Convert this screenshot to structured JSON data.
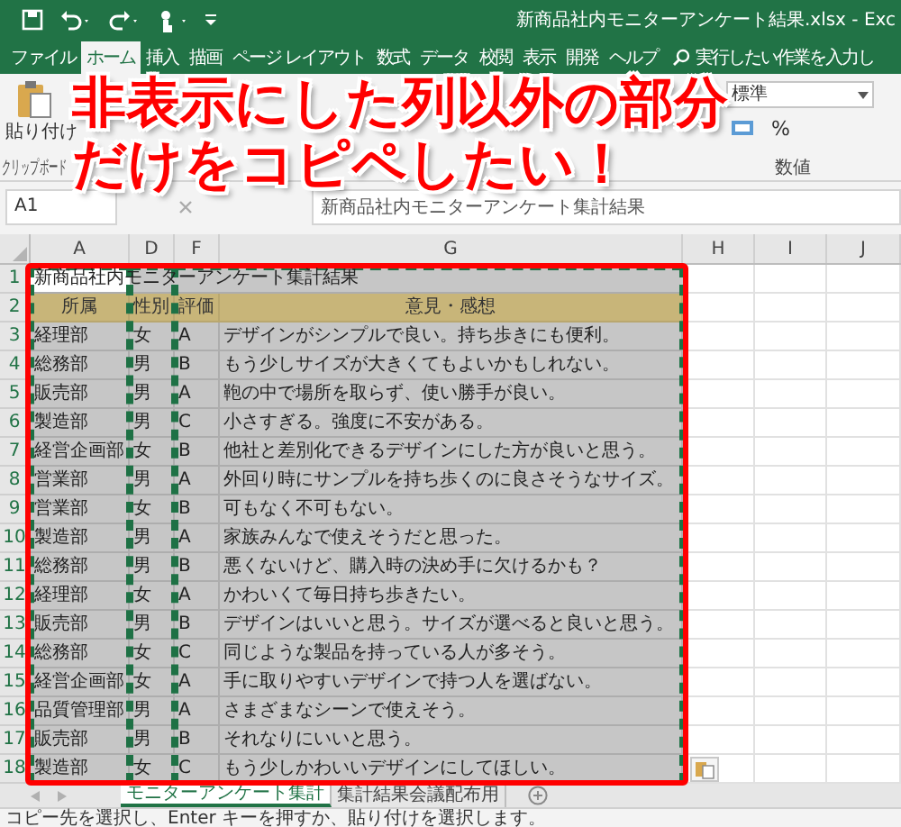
{
  "title_bar": {
    "title": "新商品社内モニターアンケート結果.xlsx - Exc"
  },
  "ribbon_tabs": [
    {
      "label": "ファイル",
      "selected": false
    },
    {
      "label": "ホーム",
      "selected": true
    },
    {
      "label": "挿入",
      "selected": false
    },
    {
      "label": "描画",
      "selected": false
    },
    {
      "label": "ページ レイアウト",
      "selected": false
    },
    {
      "label": "数式",
      "selected": false
    },
    {
      "label": "データ",
      "selected": false
    },
    {
      "label": "校閲",
      "selected": false
    },
    {
      "label": "表示",
      "selected": false
    },
    {
      "label": "開発",
      "selected": false
    },
    {
      "label": "ヘルプ",
      "selected": false
    }
  ],
  "tell_me": {
    "placeholder": "実行したい作業を入力し"
  },
  "ribbon": {
    "paste_label": "貼り付け",
    "clipboard_group": "クリップボード",
    "number_format": "標準",
    "percent": "%",
    "number_group": "数値"
  },
  "formula_bar": {
    "name_box": "A1",
    "formula": "新商品社内モニターアンケート集計結果"
  },
  "columns": [
    "A",
    "D",
    "F",
    "G",
    "H",
    "I",
    "J"
  ],
  "rows": [
    {
      "number": "1",
      "kind": "title",
      "text": "新商品社内モニターアンケート集計結果"
    },
    {
      "number": "2",
      "kind": "header",
      "cells": [
        "所属",
        "性別",
        "評価",
        "意見・感想"
      ]
    },
    {
      "number": "3",
      "kind": "data",
      "cells": [
        "経理部",
        "女",
        "A",
        "デザインがシンプルで良い。持ち歩きにも便利。"
      ]
    },
    {
      "number": "4",
      "kind": "data",
      "cells": [
        "総務部",
        "男",
        "B",
        "もう少しサイズが大きくてもよいかもしれない。"
      ]
    },
    {
      "number": "5",
      "kind": "data",
      "cells": [
        "販売部",
        "男",
        "A",
        "鞄の中で場所を取らず、使い勝手が良い。"
      ]
    },
    {
      "number": "6",
      "kind": "data",
      "cells": [
        "製造部",
        "男",
        "C",
        "小さすぎる。強度に不安がある。"
      ]
    },
    {
      "number": "7",
      "kind": "data",
      "cells": [
        "経営企画部",
        "女",
        "B",
        "他社と差別化できるデザインにした方が良いと思う。"
      ]
    },
    {
      "number": "8",
      "kind": "data",
      "cells": [
        "営業部",
        "男",
        "A",
        "外回り時にサンプルを持ち歩くのに良さそうなサイズ。"
      ]
    },
    {
      "number": "9",
      "kind": "data",
      "cells": [
        "営業部",
        "女",
        "B",
        "可もなく不可もない。"
      ]
    },
    {
      "number": "10",
      "kind": "data",
      "cells": [
        "製造部",
        "男",
        "A",
        "家族みんなで使えそうだと思った。"
      ]
    },
    {
      "number": "11",
      "kind": "data",
      "cells": [
        "総務部",
        "男",
        "B",
        "悪くないけど、購入時の決め手に欠けるかも？"
      ]
    },
    {
      "number": "12",
      "kind": "data",
      "cells": [
        "経理部",
        "女",
        "A",
        "かわいくて毎日持ち歩きたい。"
      ]
    },
    {
      "number": "13",
      "kind": "data",
      "cells": [
        "販売部",
        "男",
        "B",
        "デザインはいいと思う。サイズが選べると良いと思う。"
      ]
    },
    {
      "number": "14",
      "kind": "data",
      "cells": [
        "総務部",
        "女",
        "C",
        "同じような製品を持っている人が多そう。"
      ]
    },
    {
      "number": "15",
      "kind": "data",
      "cells": [
        "経営企画部",
        "女",
        "A",
        "手に取りやすいデザインで持つ人を選ばない。"
      ]
    },
    {
      "number": "16",
      "kind": "data",
      "cells": [
        "品質管理部",
        "男",
        "A",
        "さまざまなシーンで使えそう。"
      ]
    },
    {
      "number": "17",
      "kind": "data",
      "cells": [
        "販売部",
        "男",
        "B",
        "それなりにいいと思う。"
      ]
    },
    {
      "number": "18",
      "kind": "data",
      "cells": [
        "製造部",
        "女",
        "C",
        "もう少しかわいいデザインにしてほしい。"
      ]
    }
  ],
  "sheet_tabs": [
    {
      "label": "モニターアンケート集計",
      "selected": true
    },
    {
      "label": "集計結果会議配布用",
      "selected": false
    }
  ],
  "status_bar": {
    "message": "コピー先を選択し、Enter キーを押すか、貼り付けを選択します。"
  },
  "callout": {
    "lines": [
      "非表示にした列以外の部分",
      "だけをコピペしたい！"
    ]
  }
}
